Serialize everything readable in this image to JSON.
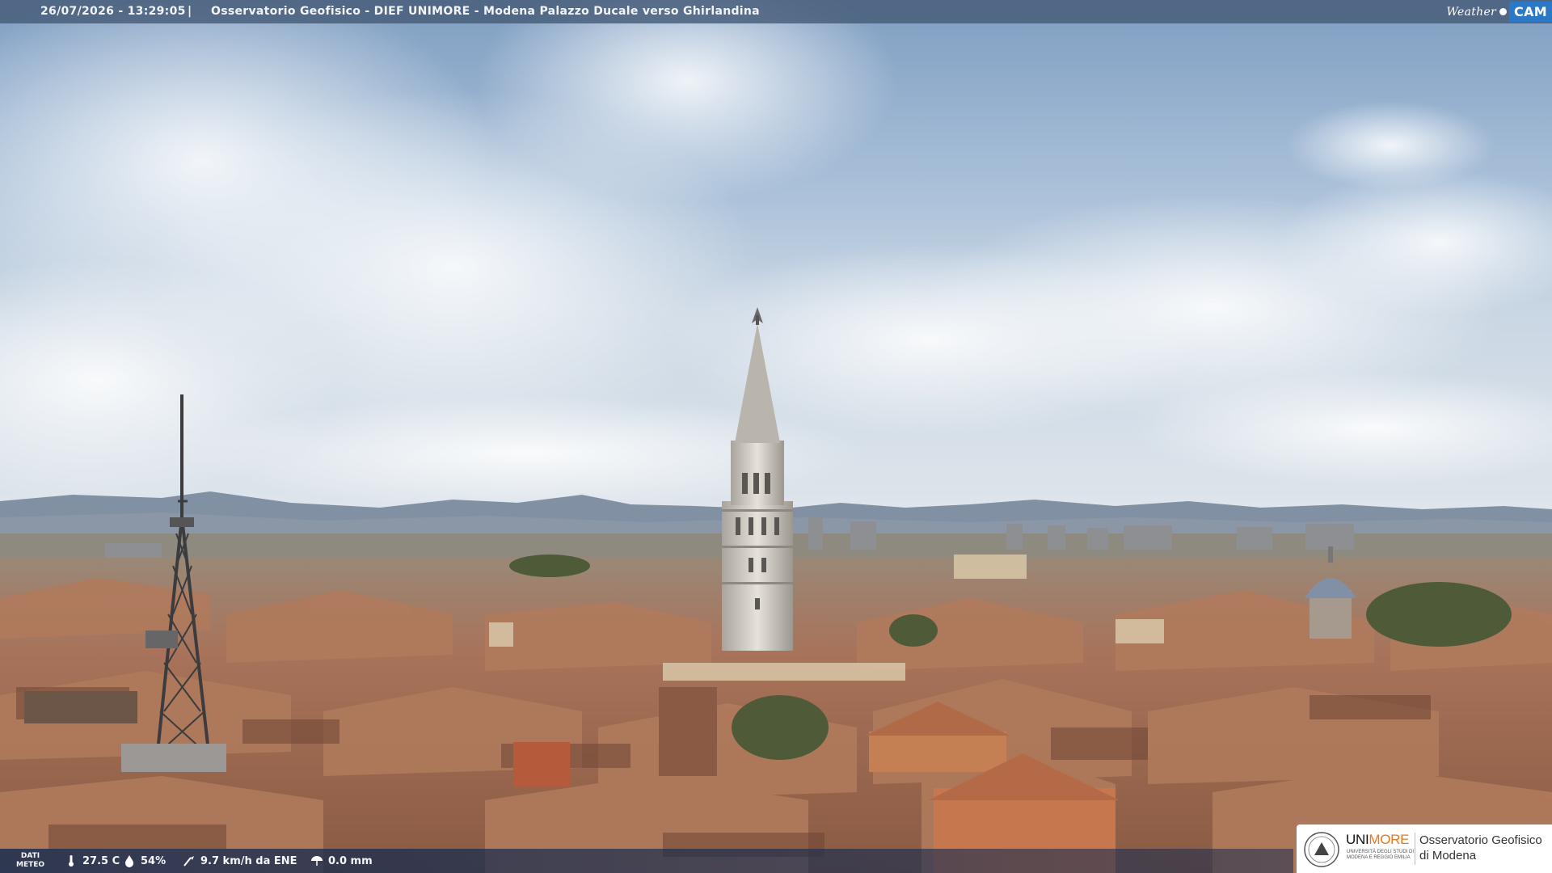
{
  "header": {
    "timestamp": "26/07/2026 - 13:29:05",
    "separator": "|",
    "title": "Osservatorio Geofisico - DIEF UNIMORE - Modena Palazzo Ducale verso Ghirlandina",
    "brand_weather": "Weather",
    "brand_cam": "CAM"
  },
  "footer": {
    "dati_label_1": "DATI",
    "dati_label_2": "METEO",
    "temperature": "27.5 C",
    "humidity": "54%",
    "wind": "9.7 km/h da ENE",
    "rain": "0.0 mm"
  },
  "logo": {
    "uni": "UNI",
    "more": "MORE",
    "small_line_1": "UNIVERSITÀ DEGLI STUDI DI",
    "small_line_2": "MODENA E REGGIO EMILIA",
    "org_line_1": "Osservatorio Geofisico",
    "org_line_2": "di Modena"
  },
  "icons": [
    "thermometer-icon",
    "humidity-icon",
    "wind-icon",
    "rain-icon",
    "unimore-seal-icon"
  ]
}
